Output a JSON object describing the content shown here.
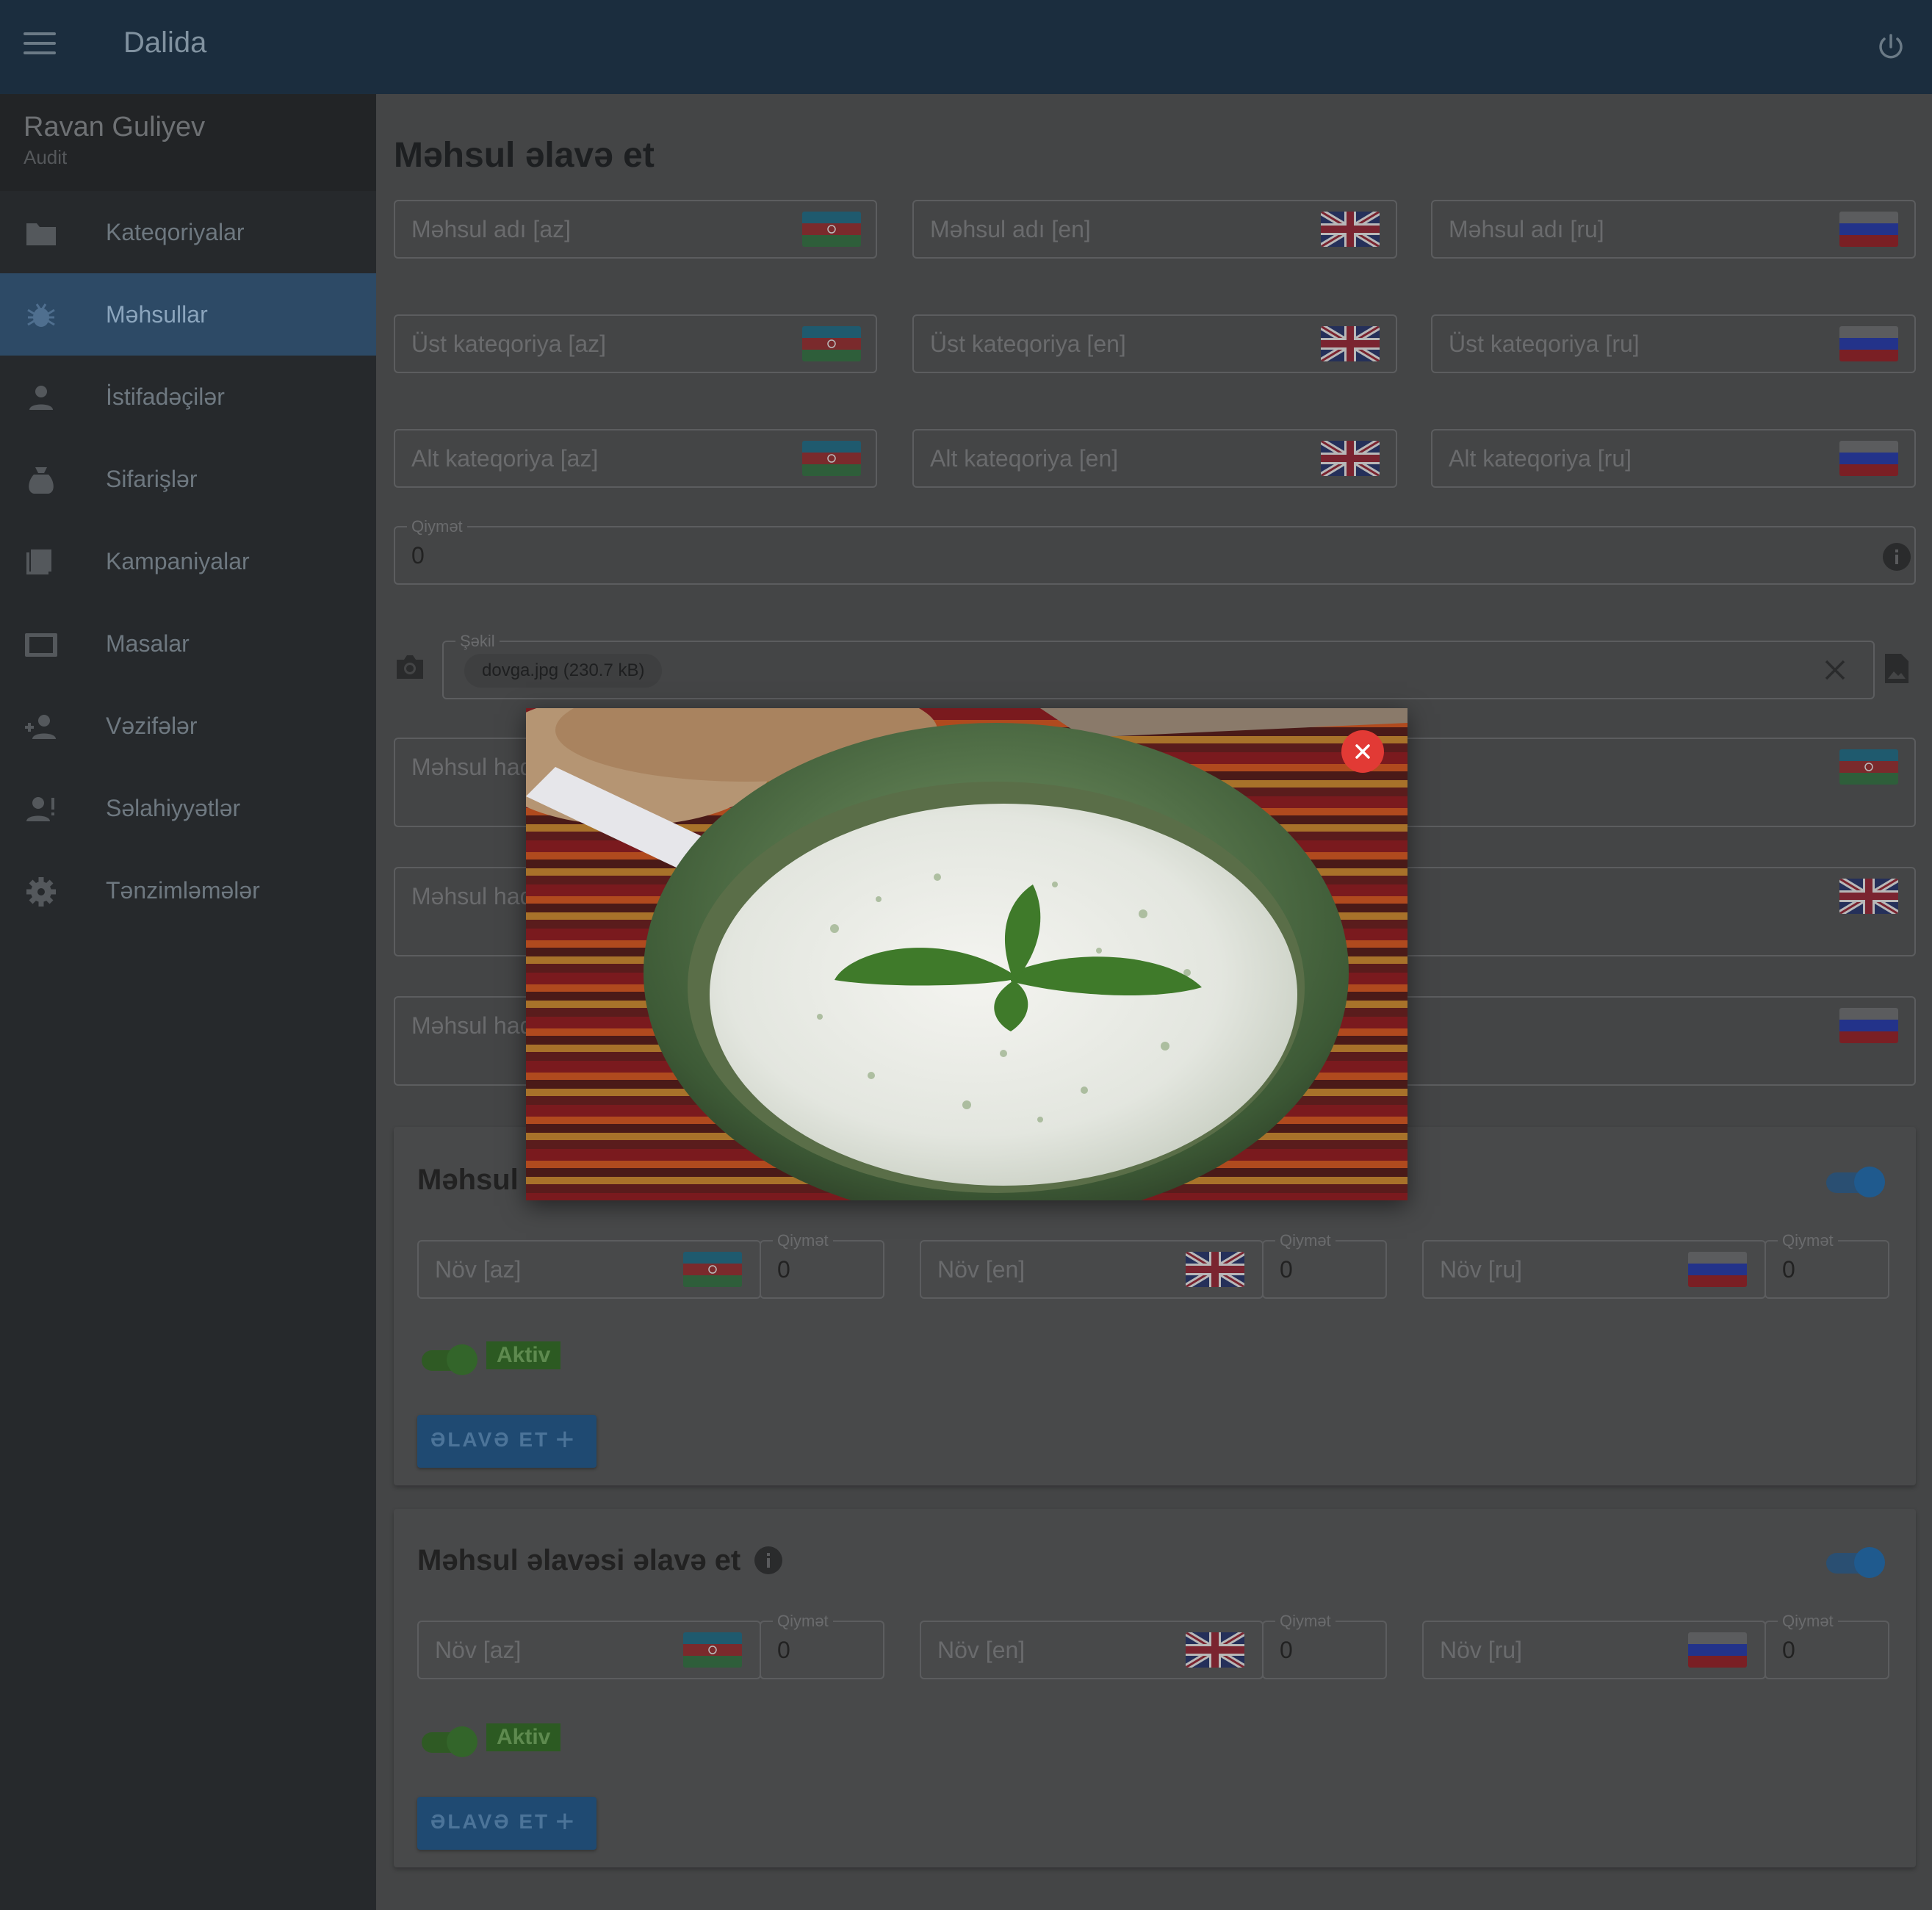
{
  "app": {
    "title": "Dalida"
  },
  "user": {
    "name": "Ravan Guliyev",
    "role": "Audit"
  },
  "sidebar": {
    "items": [
      {
        "label": "Kateqoriyalar",
        "icon": "folder-icon"
      },
      {
        "label": "Məhsullar",
        "icon": "bug-icon",
        "active": true
      },
      {
        "label": "İstifadəçilər",
        "icon": "person-icon"
      },
      {
        "label": "Sifarişlər",
        "icon": "sack-icon"
      },
      {
        "label": "Kampaniyalar",
        "icon": "notebook-icon"
      },
      {
        "label": "Masalar",
        "icon": "tablet-icon"
      },
      {
        "label": "Vəzifələr",
        "icon": "people-icon"
      },
      {
        "label": "Səlahiyyətlər",
        "icon": "person-alert-icon"
      },
      {
        "label": "Tənzimləmələr",
        "icon": "gear-icon"
      }
    ]
  },
  "page": {
    "title": "Məhsul əlavə et"
  },
  "form": {
    "name_az": "Məhsul adı [az]",
    "name_en": "Məhsul adı [en]",
    "name_ru": "Məhsul adı [ru]",
    "top_cat_az": "Üst kateqoriya [az]",
    "top_cat_en": "Üst kateqoriya [en]",
    "top_cat_ru": "Üst kateqoriya [ru]",
    "sub_cat_az": "Alt kateqoriya [az]",
    "sub_cat_en": "Alt kateqoriya [en]",
    "sub_cat_ru": "Alt kateqoriya [ru]",
    "price_label": "Qiymət",
    "price_value": "0",
    "image_label": "Şəkil",
    "image_chip": "dovga.jpg (230.7 kB)",
    "about_partial": "Məhsul haq"
  },
  "variants_card": {
    "title_partial": "Məhsul",
    "nov_az": "Növ [az]",
    "nov_en": "Növ [en]",
    "nov_ru": "Növ [ru]",
    "price_label": "Qiymət",
    "price_value": "0",
    "aktiv": "Aktiv",
    "add_label": "ƏLAVƏ ET",
    "add_icon": "+"
  },
  "extras_card": {
    "title": "Məhsul əlavəsi əlavə et",
    "nov_az": "Növ [az]",
    "nov_en": "Növ [en]",
    "nov_ru": "Növ [ru]",
    "price_label": "Qiymət",
    "price_value": "0",
    "aktiv": "Aktiv",
    "add_label": "ƏLAVƏ ET",
    "add_icon": "+"
  },
  "colors": {
    "topbar": "#1b2d3e",
    "sidebar_active": "#2d4a66",
    "accent": "#1f4a72",
    "close_button": "#e23a35",
    "aktiv_badge": "#2c5a22"
  }
}
